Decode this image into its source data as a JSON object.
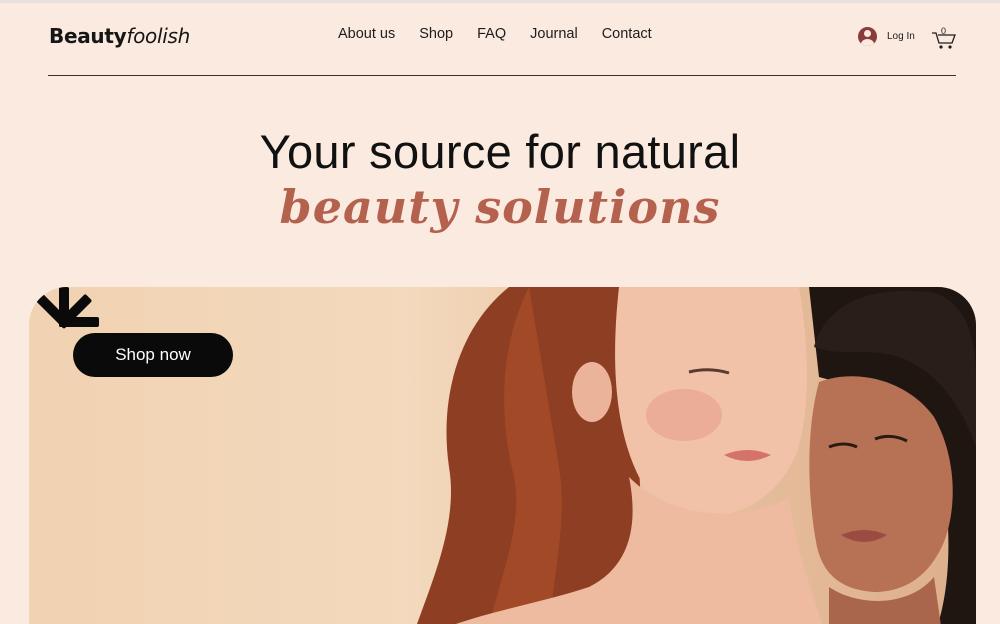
{
  "brand": {
    "name_bold": "Beauty",
    "name_light": "foolish"
  },
  "nav": {
    "items": [
      {
        "label": "About us"
      },
      {
        "label": "Shop"
      },
      {
        "label": "FAQ"
      },
      {
        "label": "Journal"
      },
      {
        "label": "Contact"
      }
    ]
  },
  "account": {
    "login_label": "Log In",
    "avatar_icon": "user-avatar-icon"
  },
  "cart": {
    "count": "0",
    "icon": "cart-icon"
  },
  "hero": {
    "title": "Your source for natural",
    "accent": "beauty solutions",
    "cta_label": "Shop now",
    "image": "two-women-portrait",
    "decorative_icon": "asterisk-star-icon"
  },
  "colors": {
    "background": "#fbeae0",
    "accent": "#b4614e",
    "button": "#0a0a0a",
    "text": "#1d1d1d"
  }
}
